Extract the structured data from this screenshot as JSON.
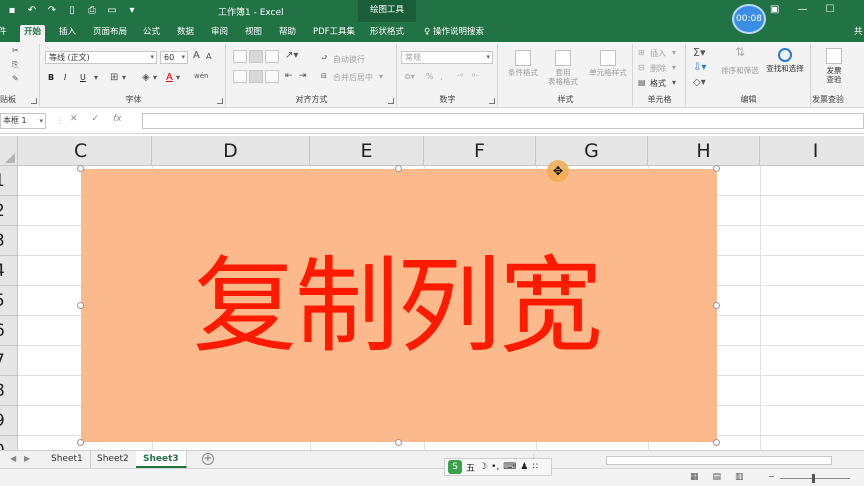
{
  "window": {
    "title": "工作簿1  -  Excel",
    "context_title": "绘图工具",
    "timer": "00:08"
  },
  "tabs": [
    {
      "label": "件",
      "active": false
    },
    {
      "label": "开始",
      "active": true
    },
    {
      "label": "插入",
      "active": false
    },
    {
      "label": "页面布局",
      "active": false
    },
    {
      "label": "公式",
      "active": false
    },
    {
      "label": "数据",
      "active": false
    },
    {
      "label": "审阅",
      "active": false
    },
    {
      "label": "视图",
      "active": false
    },
    {
      "label": "帮助",
      "active": false
    },
    {
      "label": "PDF工具集",
      "active": false
    },
    {
      "label": "形状格式",
      "active": false
    },
    {
      "label": "操作说明搜索",
      "active": false
    },
    {
      "label": "共",
      "active": false
    }
  ],
  "ribbon": {
    "clipboard_label": "贴板",
    "font_label": "字体",
    "font_name": "等线 (正文)",
    "font_size": "60",
    "font_grow": "A",
    "font_shrink": "A",
    "bold": "B",
    "italic": "I",
    "underline": "U",
    "wen": "wén",
    "alignment_label": "对齐方式",
    "wrap_text": "自动换行",
    "merge_center": "合并后居中",
    "number_label": "数字",
    "number_format": "常规",
    "percent": "%",
    "comma": ",",
    "styles_label": "样式",
    "conditional_format": "条件格式",
    "table_format_1": "套用",
    "table_format_2": "表格格式",
    "cell_styles": "单元格样式",
    "cells_label": "单元格",
    "insert": "插入",
    "delete": "删除",
    "format": "格式",
    "editing_label": "编辑",
    "sort_filter": "排序和筛选",
    "find_select": "查找和选择",
    "invoice_1": "发票",
    "invoice_2": "查验",
    "invoice_group": "发票查验"
  },
  "formula_bar": {
    "name_box": "本框 1",
    "cancel": "✕",
    "enter": "✓",
    "fx": "fx"
  },
  "columns": [
    "C",
    "D",
    "E",
    "F",
    "G",
    "H",
    "I"
  ],
  "rows": [
    "1",
    "2",
    "3",
    "4",
    "5",
    "6",
    "7",
    "8",
    "9",
    "0"
  ],
  "shape": {
    "text": "复制列宽",
    "fill": "#fbb98c",
    "text_color": "#ff1a00"
  },
  "sheets": [
    {
      "name": "Sheet1",
      "active": false
    },
    {
      "name": "Sheet2",
      "active": false
    },
    {
      "name": "Sheet3",
      "active": true
    }
  ],
  "ime": {
    "logo": "S",
    "mode": "五"
  },
  "colors": {
    "excel_green": "#217346",
    "ribbon_bg": "#f3f3f3"
  }
}
